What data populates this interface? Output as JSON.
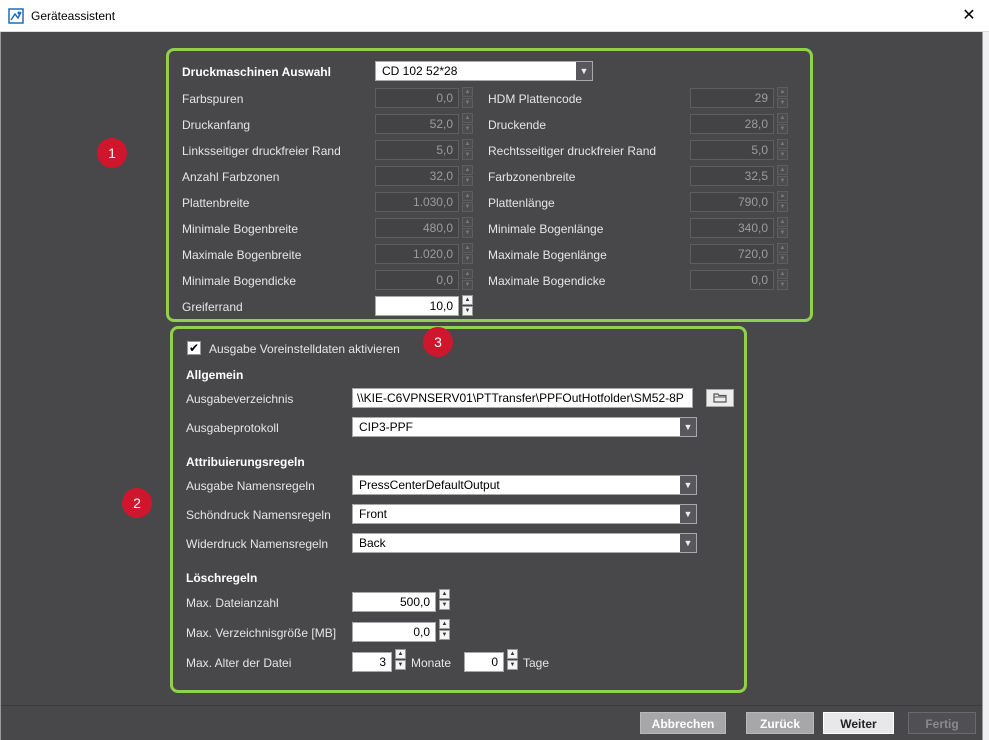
{
  "window": {
    "title": "Geräteassistent",
    "close_glyph": "✕"
  },
  "markers": [
    "1",
    "2",
    "3"
  ],
  "press": {
    "heading": "Druckmaschinen Auswahl",
    "selected_machine": "CD 102 52*28",
    "left_fields": [
      {
        "label": "Farbspuren",
        "value": "0,0"
      },
      {
        "label": "Druckanfang",
        "value": "52,0"
      },
      {
        "label": "Linksseitiger druckfreier Rand",
        "value": "5,0"
      },
      {
        "label": "Anzahl Farbzonen",
        "value": "32,0"
      },
      {
        "label": "Plattenbreite",
        "value": "1.030,0"
      },
      {
        "label": "Minimale Bogenbreite",
        "value": "480,0"
      },
      {
        "label": "Maximale Bogenbreite",
        "value": "1.020,0"
      },
      {
        "label": "Minimale Bogendicke",
        "value": "0,0"
      },
      {
        "label": "Greiferrand",
        "value": "10,0"
      }
    ],
    "right_fields": [
      {
        "label": "HDM Plattencode",
        "value": "29"
      },
      {
        "label": "Druckende",
        "value": "28,0"
      },
      {
        "label": "Rechtsseitiger druckfreier Rand",
        "value": "5,0"
      },
      {
        "label": "Farbzonenbreite",
        "value": "32,5"
      },
      {
        "label": "Plattenlänge",
        "value": "790,0"
      },
      {
        "label": "Minimale Bogenlänge",
        "value": "340,0"
      },
      {
        "label": "Maximale Bogenlänge",
        "value": "720,0"
      },
      {
        "label": "Maximale Bogendicke",
        "value": "0,0"
      }
    ]
  },
  "output": {
    "checkbox_label": "Ausgabe Voreinstelldaten aktivieren",
    "checkbox_checked": true,
    "check_glyph": "✔",
    "general": {
      "heading": "Allgemein",
      "dir_label": "Ausgabeverzeichnis",
      "dir_value": "\\\\KIE-C6VPNSERV01\\PTTransfer\\PPFOutHotfolder\\SM52-8P",
      "protocol_label": "Ausgabeprotokoll",
      "protocol_value": "CIP3-PPF"
    },
    "naming": {
      "heading": "Attribuierungsregeln",
      "output_label": "Ausgabe Namensregeln",
      "output_value": "PressCenterDefaultOutput",
      "front_label": "Schöndruck Namensregeln",
      "front_value": "Front",
      "back_label": "Widerdruck Namensregeln",
      "back_value": "Back"
    },
    "delete": {
      "heading": "Löschregeln",
      "max_files_label": "Max. Dateianzahl",
      "max_files_value": "500,0",
      "max_size_label": "Max. Verzeichnisgröße [MB]",
      "max_size_value": "0,0",
      "max_age_label": "Max. Alter der Datei",
      "months_value": "3",
      "months_label": "Monate",
      "days_value": "0",
      "days_label": "Tage"
    }
  },
  "buttons": {
    "cancel": "Abbrechen",
    "back": "Zurück",
    "next": "Weiter",
    "finish": "Fertig"
  },
  "colors": {
    "frame": "#8fd14f",
    "marker": "#d0162c",
    "background": "#48484b"
  }
}
